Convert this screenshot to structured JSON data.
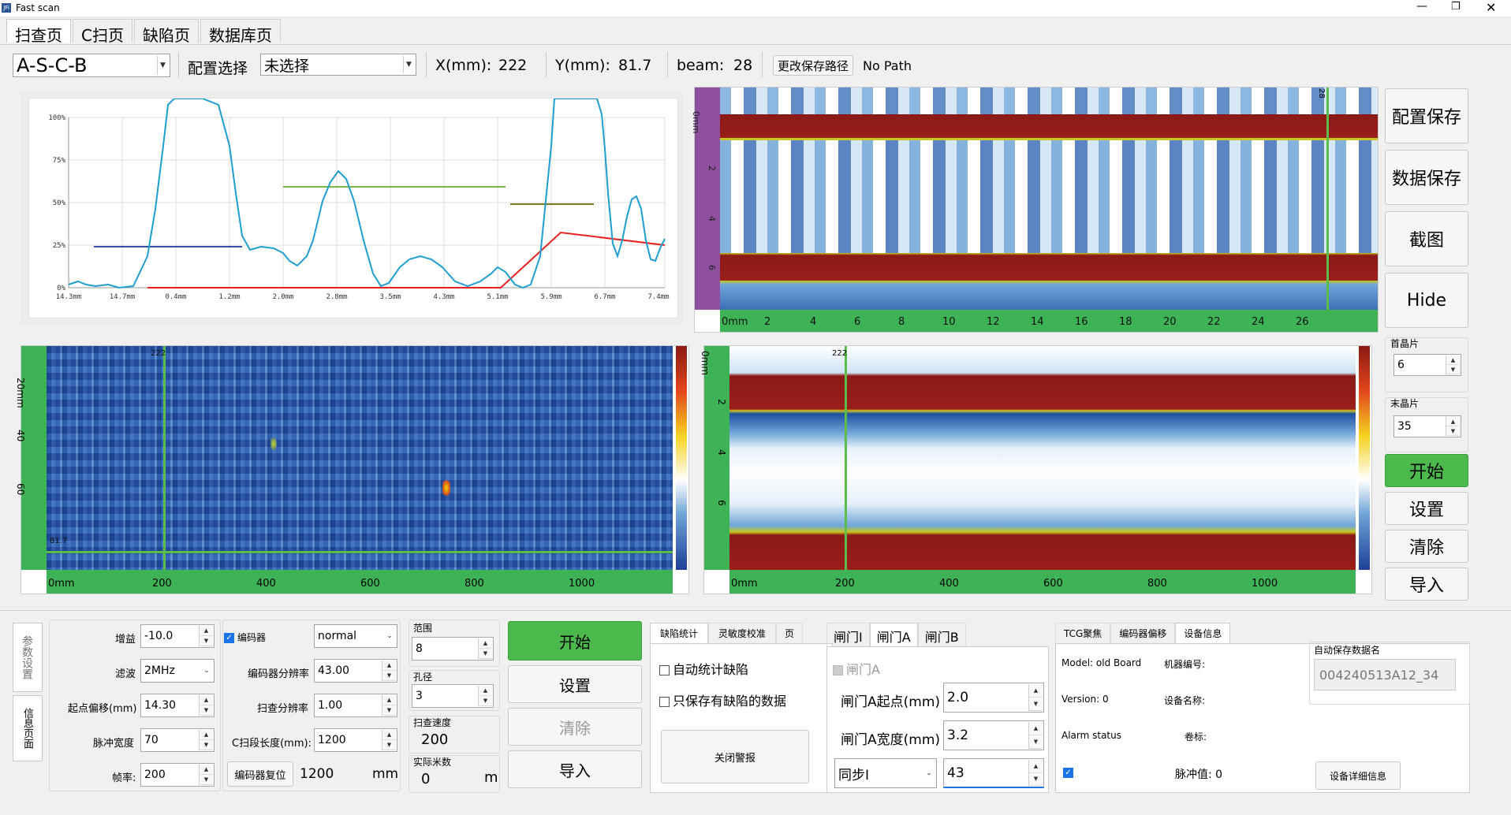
{
  "window": {
    "title": "Fast scan"
  },
  "tabs": [
    "扫查页",
    "C扫页",
    "缺陷页",
    "数据库页"
  ],
  "toolbar": {
    "mode": "A-S-C-B",
    "config_label": "配置选择",
    "config_value": "未选择",
    "x_label": "X(mm):",
    "x_value": "222",
    "y_label": "Y(mm):",
    "y_value": "81.7",
    "beam_label": "beam:",
    "beam_value": "28",
    "change_path_btn": "更改保存路径",
    "path_value": "No Path"
  },
  "ascan": {
    "y_ticks": [
      "100%",
      "75%",
      "50%",
      "25%",
      "0%"
    ],
    "x_ticks": [
      "14.3mm",
      "14.7mm",
      "0.4mm",
      "1.2mm",
      "2.0mm",
      "2.8mm",
      "3.5mm",
      "4.3mm",
      "5.1mm",
      "5.9mm",
      "6.7mm",
      "7.4mm"
    ]
  },
  "sscan": {
    "depth_ticks": [
      "0mm",
      "2",
      "4",
      "6"
    ],
    "x_ticks": [
      "0mm",
      "2",
      "4",
      "6",
      "8",
      "10",
      "12",
      "14",
      "16",
      "18",
      "20",
      "22",
      "24",
      "26"
    ],
    "cursor_label": "28"
  },
  "cscan": {
    "y_ticks": [
      "20mm",
      "40",
      "60"
    ],
    "x_ticks": [
      "0mm",
      "200",
      "400",
      "600",
      "800",
      "1000"
    ],
    "cursor_x": "222",
    "cursor_y": "81.7"
  },
  "bscan": {
    "depth_ticks": [
      "0mm",
      "2",
      "4",
      "6"
    ],
    "x_ticks": [
      "0mm",
      "200",
      "400",
      "600",
      "800",
      "1000"
    ],
    "cursor_x": "222"
  },
  "right_panel": {
    "save_config": "配置保存",
    "save_data": "数据保存",
    "screenshot": "截图",
    "hide": "Hide",
    "first_label": "首晶片",
    "first_value": "6",
    "last_label": "末晶片",
    "last_value": "35",
    "start": "开始",
    "settings": "设置",
    "clear": "清除",
    "import": "导入"
  },
  "side_tabs": [
    "参数设置",
    "信息页面"
  ],
  "params": {
    "gain_label": "增益",
    "gain": "-10.0",
    "filter_label": "滤波",
    "filter": "2MHz",
    "offset_label": "起点偏移(mm)",
    "offset": "14.30",
    "pulse_label": "脉冲宽度",
    "pulse": "70",
    "rate_label": "帧率:",
    "rate": "200"
  },
  "encoder": {
    "enc_label": "编码器",
    "mode": "normal",
    "res_label": "编码器分辨率",
    "res": "43.00",
    "scan_res_label": "扫查分辨率",
    "scan_res": "1.00",
    "seg_label": "C扫段长度(mm):",
    "seg": "1200",
    "reset_btn": "编码器复位",
    "reset_value": "1200",
    "unit": "mm"
  },
  "range": {
    "range_label": "范围",
    "range": "8",
    "aperture_label": "孔径",
    "aperture": "3",
    "speed_label": "扫查速度",
    "speed": "200",
    "meter_label": "实际米数",
    "meter": "0",
    "meter_unit": "m"
  },
  "actions": {
    "start": "开始",
    "settings": "设置",
    "clear": "清除",
    "import": "导入"
  },
  "defect": {
    "tabs": [
      "缺陷统计",
      "灵敏度校准",
      "页"
    ],
    "auto_stat": "自动统计缺陷",
    "only_defect": "只保存有缺陷的数据",
    "close_alarm": "关闭警报"
  },
  "gate": {
    "tabs": [
      "闸门I",
      "闸门A",
      "闸门B"
    ],
    "gate_a": "闸门A",
    "start_label": "闸门A起点(mm)",
    "start": "2.0",
    "width_label": "闸门A宽度(mm)",
    "width": "3.2",
    "sync": "同步I",
    "sync_value": "43"
  },
  "device": {
    "tabs": [
      "TCG聚焦",
      "编码器偏移",
      "设备信息"
    ],
    "model": "Model: old Board",
    "machine_no": "机器编号:",
    "version": "Version: 0",
    "device_name": "设备名称:",
    "alarm": "Alarm status",
    "coil": "卷标:",
    "pulse_val": "脉冲值: 0",
    "detail_btn": "设备详细信息",
    "auto_save_label": "自动保存数据名",
    "auto_save_value": "004240513A12_34"
  }
}
